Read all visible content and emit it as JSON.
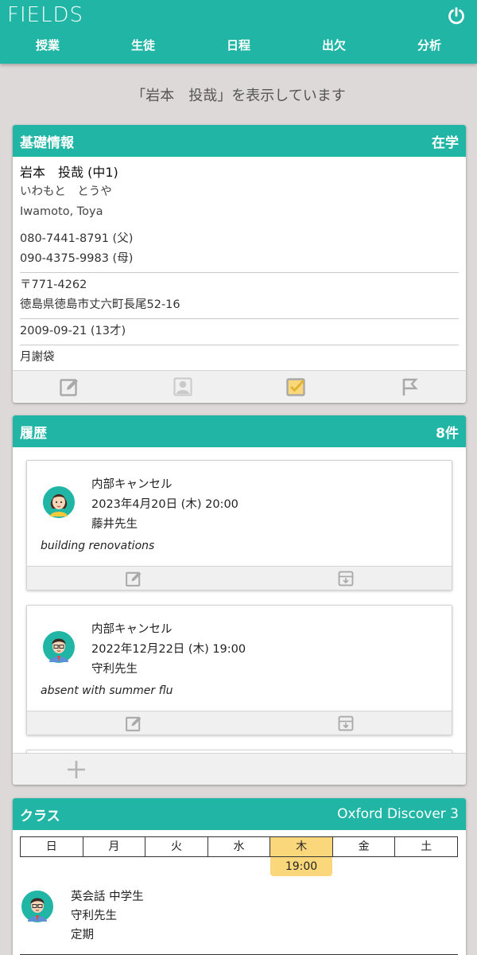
{
  "app": {
    "logo": "FIELDS",
    "power_icon": "power-icon"
  },
  "nav": {
    "tabs": [
      "授業",
      "生徒",
      "日程",
      "出欠",
      "分析"
    ]
  },
  "notice": "「岩本　投哉」を表示しています",
  "basic": {
    "title": "基礎情報",
    "status": "在学",
    "name": "岩本　投哉 (中1)",
    "kana": "いわもと　とうや",
    "roman": "Iwamoto, Toya",
    "phones": [
      "080-7441-8791 (父)",
      "090-4375-9983 (母)"
    ],
    "postal": "〒771-4262",
    "address": "徳島県徳島市丈六町長尾52-16",
    "birth": "2009-09-21 (13才)",
    "payment": "月謝袋",
    "toolbar_icons": [
      "edit-icon",
      "profile-icon",
      "checkbox-icon",
      "flag-icon"
    ]
  },
  "history": {
    "title": "履歴",
    "count": "8件",
    "entries": [
      {
        "type": "内部キャンセル",
        "datetime": "2023年4月20日 (木) 20:00",
        "teacher": "藤井先生",
        "note": "building renovations",
        "avatar": "female-teacher-avatar"
      },
      {
        "type": "内部キャンセル",
        "datetime": "2022年12月22日 (木) 19:00",
        "teacher": "守利先生",
        "note": "absent with summer flu",
        "avatar": "male-teacher-avatar"
      }
    ]
  },
  "class": {
    "title": "クラス",
    "course": "Oxford Discover 3",
    "days": [
      "日",
      "月",
      "火",
      "水",
      "木",
      "金",
      "土"
    ],
    "active_day": "木",
    "time": "19:00",
    "name": "英会話 中学生",
    "teacher": "守利先生",
    "kind": "定期"
  },
  "colors": {
    "accent": "#20b5a5",
    "highlight": "#fbd77b",
    "background": "#dcd9d8"
  }
}
